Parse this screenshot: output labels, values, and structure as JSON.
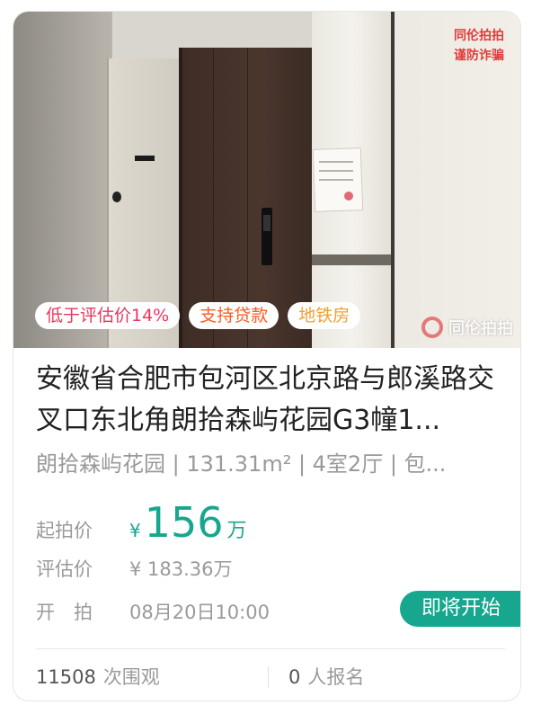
{
  "photo": {
    "watermark_top_line1": "同伦拍拍",
    "watermark_top_line2": "谨防诈骗",
    "watermark_logo": "同伦拍拍"
  },
  "tags": [
    {
      "label": "低于评估价14%"
    },
    {
      "label": "支持贷款"
    },
    {
      "label": "地铁房"
    }
  ],
  "listing": {
    "title": "安徽省合肥市包河区北京路与郎溪路交叉口东北角朗拾森屿花园G3幢1...",
    "subtitle": "朗拾森屿花园 | 131.31m² | 4室2厅 | 包..."
  },
  "price": {
    "label": "起拍价",
    "currency": "¥",
    "amount": "156",
    "unit": "万"
  },
  "evaluation": {
    "label": "评估价",
    "value": "¥ 183.36万"
  },
  "start": {
    "label": "开　拍",
    "value": "08月20日10:00"
  },
  "status": {
    "label": "即将开始"
  },
  "footer": {
    "views_count": "11508",
    "views_label": "次围观",
    "signup_count": "0",
    "signup_label": "人报名"
  },
  "colors": {
    "accent": "#17a78e",
    "tag_discount": "#e8365d",
    "tag_loan": "#ff5a1f",
    "tag_metro": "#f0a030",
    "watermark": "#e23a3a"
  }
}
